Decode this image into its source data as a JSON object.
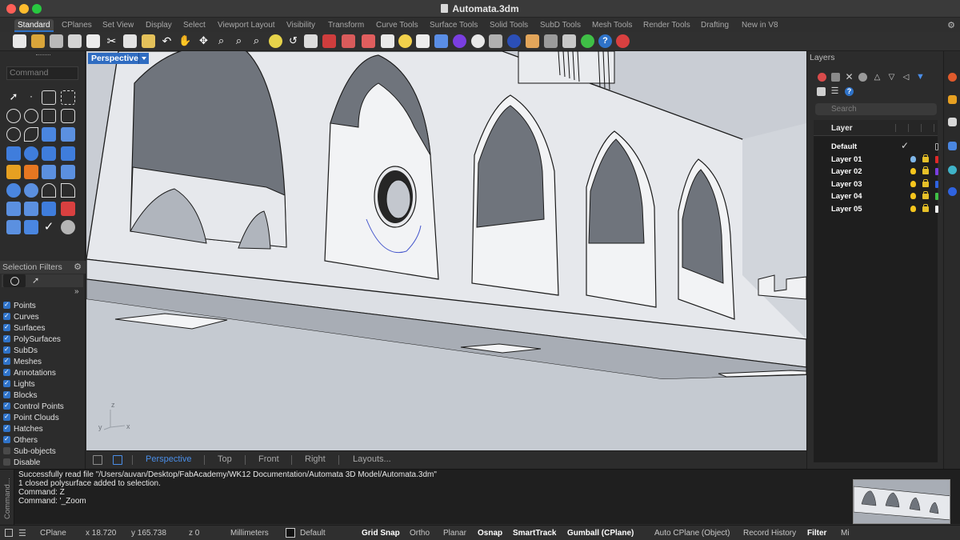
{
  "window": {
    "title": "Automata.3dm"
  },
  "tabs": [
    "Standard",
    "CPlanes",
    "Set View",
    "Display",
    "Select",
    "Viewport Layout",
    "Visibility",
    "Transform",
    "Curve Tools",
    "Surface Tools",
    "Solid Tools",
    "SubD Tools",
    "Mesh Tools",
    "Render Tools",
    "Drafting",
    "New in V8"
  ],
  "left": {
    "command_placeholder": "Command",
    "selection_filters_title": "Selection Filters",
    "filters": [
      {
        "label": "Points",
        "checked": true
      },
      {
        "label": "Curves",
        "checked": true
      },
      {
        "label": "Surfaces",
        "checked": true
      },
      {
        "label": "PolySurfaces",
        "checked": true
      },
      {
        "label": "SubDs",
        "checked": true
      },
      {
        "label": "Meshes",
        "checked": true
      },
      {
        "label": "Annotations",
        "checked": true
      },
      {
        "label": "Lights",
        "checked": true
      },
      {
        "label": "Blocks",
        "checked": true
      },
      {
        "label": "Control Points",
        "checked": true
      },
      {
        "label": "Point Clouds",
        "checked": true
      },
      {
        "label": "Hatches",
        "checked": true
      },
      {
        "label": "Others",
        "checked": true
      },
      {
        "label": "Sub-objects",
        "checked": false
      },
      {
        "label": "Disable",
        "checked": false
      }
    ]
  },
  "viewport": {
    "label": "Perspective",
    "axes": {
      "x": "x",
      "y": "y",
      "z": "z"
    },
    "tabs": [
      "Perspective",
      "Top",
      "Front",
      "Right",
      "Layouts..."
    ],
    "active_tab": "Perspective"
  },
  "layers": {
    "title": "Layers",
    "search_placeholder": "Search",
    "column_header": "Layer",
    "rows": [
      {
        "name": "Default",
        "current": true,
        "bulb": "#c8c8c8",
        "color": "#111111"
      },
      {
        "name": "Layer 01",
        "current": false,
        "bulb": "#7fb6e8",
        "color": "#e02828"
      },
      {
        "name": "Layer 02",
        "current": false,
        "bulb": "#f5c51d",
        "color": "#7a3ee0"
      },
      {
        "name": "Layer 03",
        "current": false,
        "bulb": "#f5c51d",
        "color": "#2f63e0"
      },
      {
        "name": "Layer 04",
        "current": false,
        "bulb": "#f5c51d",
        "color": "#3fbf46"
      },
      {
        "name": "Layer 05",
        "current": false,
        "bulb": "#f5c51d",
        "color": "#f0f0f0"
      }
    ]
  },
  "command_history": {
    "side_label": "Command...",
    "lines": [
      "Successfully read file \"/Users/auvan/Desktop/FabAcademy/WK12 Documentation/Automata 3D Model/Automata.3dm\"",
      "1 closed polysurface added to selection.",
      "Command: Z",
      "Command: '_Zoom"
    ]
  },
  "status": {
    "cplane": "CPlane",
    "x": "x 18.720",
    "y": "y 165.738",
    "z": "z 0",
    "units": "Millimeters",
    "layer": "Default",
    "grid_snap": "Grid Snap",
    "ortho": "Ortho",
    "planar": "Planar",
    "osnap": "Osnap",
    "smarttrack": "SmartTrack",
    "gumball": "Gumball (CPlane)",
    "auto_cplane": "Auto CPlane (Object)",
    "record_history": "Record History",
    "filter": "Filter",
    "minimized": "Mi"
  },
  "colors": {
    "accent": "#2f6cc1",
    "active_tab_text": "#4a8ee8",
    "viewport_bg": "#c7cbd2"
  }
}
